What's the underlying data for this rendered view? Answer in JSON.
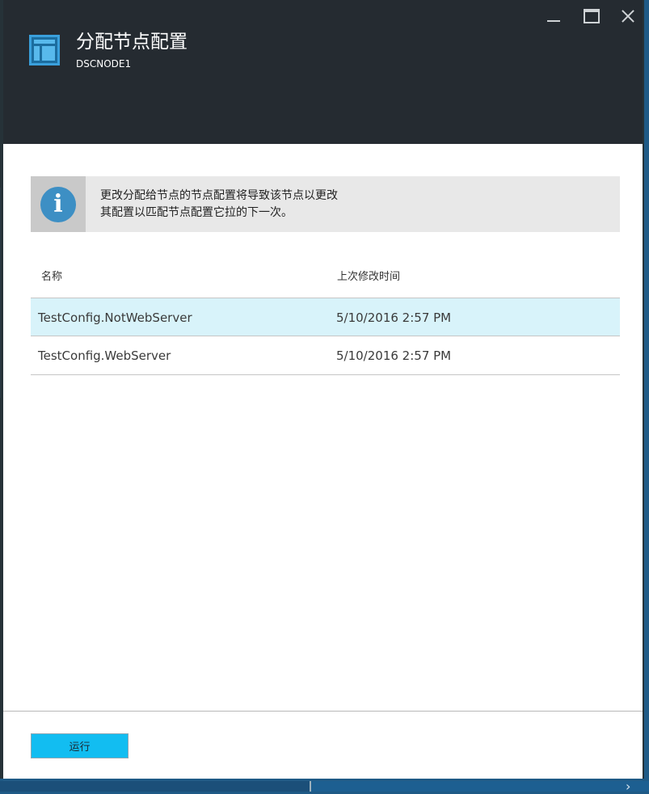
{
  "window": {
    "title": "分配节点配置",
    "subtitle": "DSCNODE1"
  },
  "info": {
    "message_line1": "更改分配给节点的节点配置将导致该节点以更改",
    "message_line2": "其配置以匹配节点配置它拉的下一次。"
  },
  "grid": {
    "columns": {
      "name": "名称",
      "last_modified": "上次修改时间"
    },
    "rows": [
      {
        "name": "TestConfig.NotWebServer",
        "last_modified": "5/10/2016 2:57 PM",
        "selected": true
      },
      {
        "name": "TestConfig.WebServer",
        "last_modified": "5/10/2016 2:57 PM",
        "selected": false
      }
    ]
  },
  "footer": {
    "run_label": "运行"
  },
  "icons": {
    "blade": "blade-icon",
    "info": "info-icon",
    "minimize": "minimize-icon",
    "maximize": "maximize-icon",
    "close": "close-icon",
    "chevron": "chevron-right-icon"
  },
  "colors": {
    "header_bg": "#252b31",
    "accent": "#12bdf1",
    "selected_row": "#d8f3fa",
    "info_icon": "#3d8fc4"
  }
}
